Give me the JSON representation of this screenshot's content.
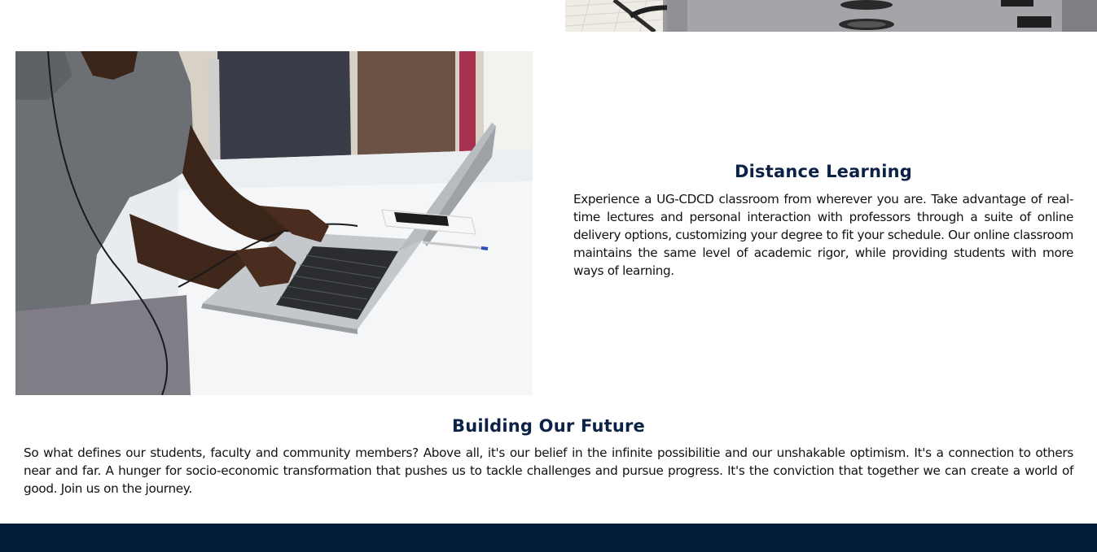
{
  "distance_learning": {
    "title": "Distance Learning",
    "body": "Experience a UG-CDCD classroom from wherever you are. Take advantage of real-time lectures and personal interaction with professors through a suite of online delivery options, customizing your degree to fit your schedule. Our online classroom maintains the same level of academic rigor, while providing students with more ways of learning."
  },
  "building_future": {
    "title": "Building Our Future",
    "body": "So what defines our students, faculty and community members? Above all, it's our belief in the infinite possibilitie and our unshakable optimism. It's a connection to others near and far. A hunger for socio-economic transformation that pushes us to tackle challenges and pursue progress. It's the conviction that together we can create a world of good. Join us on the journey."
  },
  "colors": {
    "heading": "#0b2246",
    "footer": "#021d3a"
  }
}
